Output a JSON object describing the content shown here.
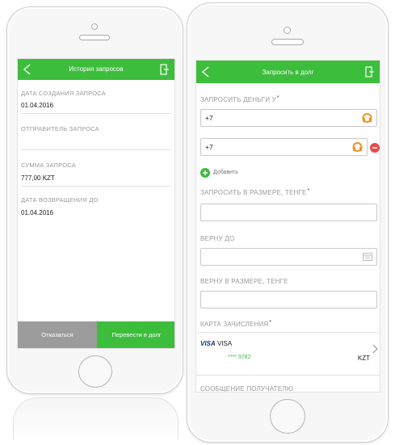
{
  "left_phone": {
    "header": {
      "title": "История запросов"
    },
    "fields": [
      {
        "label": "ДАТА СОЗДАНИЯ ЗАПРОСА",
        "value": "01.04.2016"
      },
      {
        "label": "ОТПРАВИТЕЛЬ ЗАПРОСА",
        "value": ""
      },
      {
        "label": "СУММА ЗАПРОСА",
        "value": "777,00 KZT"
      },
      {
        "label": "ДАТА ВОЗВРАЩЕНИЯ ДО",
        "value": "01.04.2016"
      }
    ],
    "buttons": {
      "cancel": "Отказаться",
      "transfer": "Перевести в долг"
    }
  },
  "right_phone": {
    "header": {
      "title": "Запросить в долг"
    },
    "request_from_label": "ЗАПРОСИТЬ ДЕНЬГИ У",
    "required_mark": "*",
    "phone_inputs": [
      "+7",
      "+7"
    ],
    "add_label": "Добавить",
    "amount_label": "ЗАПРОСИТЬ В РАЗМЕРЕ, ТЕНГЕ",
    "amount_value": "",
    "return_date_label": "ВЕРНУ ДО",
    "return_date_value": "",
    "return_amount_label": "ВЕРНУ В РАЗМЕРЕ, ТЕНГЕ",
    "return_amount_value": "",
    "card_label": "КАРТА ЗАЧИСЛЕНИЯ",
    "card": {
      "logo": "VISA",
      "name": "VISA",
      "number": "**** 9782",
      "currency": "KZT"
    },
    "message_label": "СООБЩЕНИЕ ПОЛУЧАТЕЛЮ"
  },
  "colors": {
    "accent": "#3dbd3c",
    "contact_icon": "#f0921e",
    "remove_icon": "#e64a4a",
    "card_brand": "#1a2d8c"
  },
  "icons": [
    "back-arrow-icon",
    "exit-icon",
    "contacts-icon",
    "remove-icon",
    "add-icon",
    "calendar-icon",
    "chevron-right-icon"
  ]
}
